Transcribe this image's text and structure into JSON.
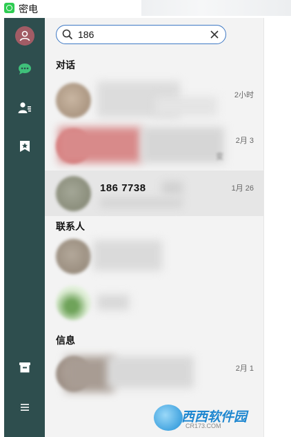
{
  "window": {
    "title": "密电"
  },
  "search": {
    "value": "186"
  },
  "sections": {
    "conversations": "对话",
    "contacts": "联系人",
    "messages": "信息"
  },
  "conversations": [
    {
      "time": "2小时"
    },
    {
      "time": "2月 3"
    },
    {
      "name": "186 7738",
      "time": "1月 26"
    }
  ],
  "messages": [
    {
      "time": "2月 1"
    }
  ],
  "colors": {
    "sidebar": "#2e4e4e",
    "active_icon": "#3fc07a",
    "search_border": "#3d78c4",
    "panel_bg": "#f3f3f3",
    "selected_row": "#e6e6e6"
  },
  "watermark": {
    "text": "西西软件园",
    "sub": "CR173.COM"
  }
}
